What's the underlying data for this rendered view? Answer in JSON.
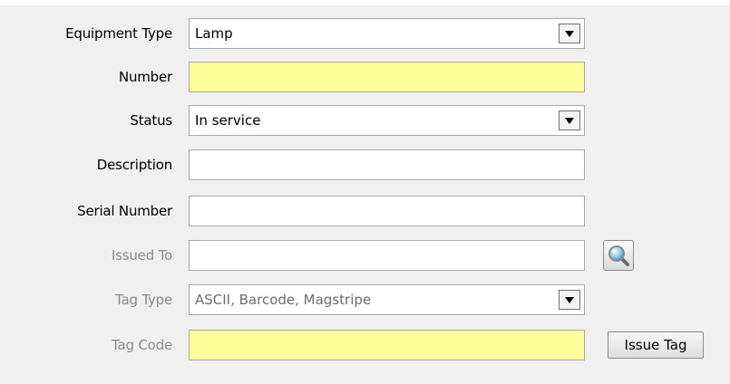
{
  "form": {
    "equipment_type": {
      "label": "Equipment Type",
      "value": "Lamp"
    },
    "number": {
      "label": "Number",
      "value": ""
    },
    "status": {
      "label": "Status",
      "value": "In service"
    },
    "description": {
      "label": "Description",
      "value": ""
    },
    "serial_number": {
      "label": "Serial Number",
      "value": ""
    },
    "issued_to": {
      "label": "Issued To",
      "value": "",
      "lookup_icon": "magnifier-search-icon"
    },
    "tag_type": {
      "label": "Tag Type",
      "value": "ASCII, Barcode, Magstripe"
    },
    "tag_code": {
      "label": "Tag Code",
      "value": "",
      "button_label": "Issue Tag"
    }
  },
  "colors": {
    "required_field": "#ffff99",
    "disabled_label": "#8a8a8a",
    "background": "#f0f0f0"
  }
}
